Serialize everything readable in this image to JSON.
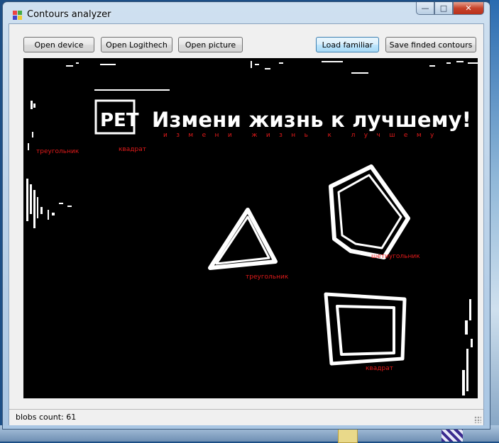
{
  "window": {
    "title": "Contours analyzer",
    "minimize_glyph": "—",
    "maximize_glyph": "□",
    "close_glyph": "✕"
  },
  "toolbar": {
    "open_device": "Open device",
    "open_logitech": "Open Logithech",
    "open_picture": "Open picture",
    "load_familiar": "Load familiar",
    "save_contours": "Save finded contours"
  },
  "canvas": {
    "banner_text": "Измени жизнь к лучшему!",
    "banner_spaced": "измени жизнь к лучшему",
    "logo_text": "PET",
    "labels": {
      "triangle_left": "треугольник",
      "square_logo": "квадрат",
      "hexagon": "шетиугольник",
      "triangle": "треугольник",
      "square": "квадрат"
    }
  },
  "status": {
    "text": "blobs count: 61"
  },
  "colors": {
    "label_red": "#e31b1b",
    "canvas_bg": "#000000",
    "hot_button": "#bee6fd"
  }
}
